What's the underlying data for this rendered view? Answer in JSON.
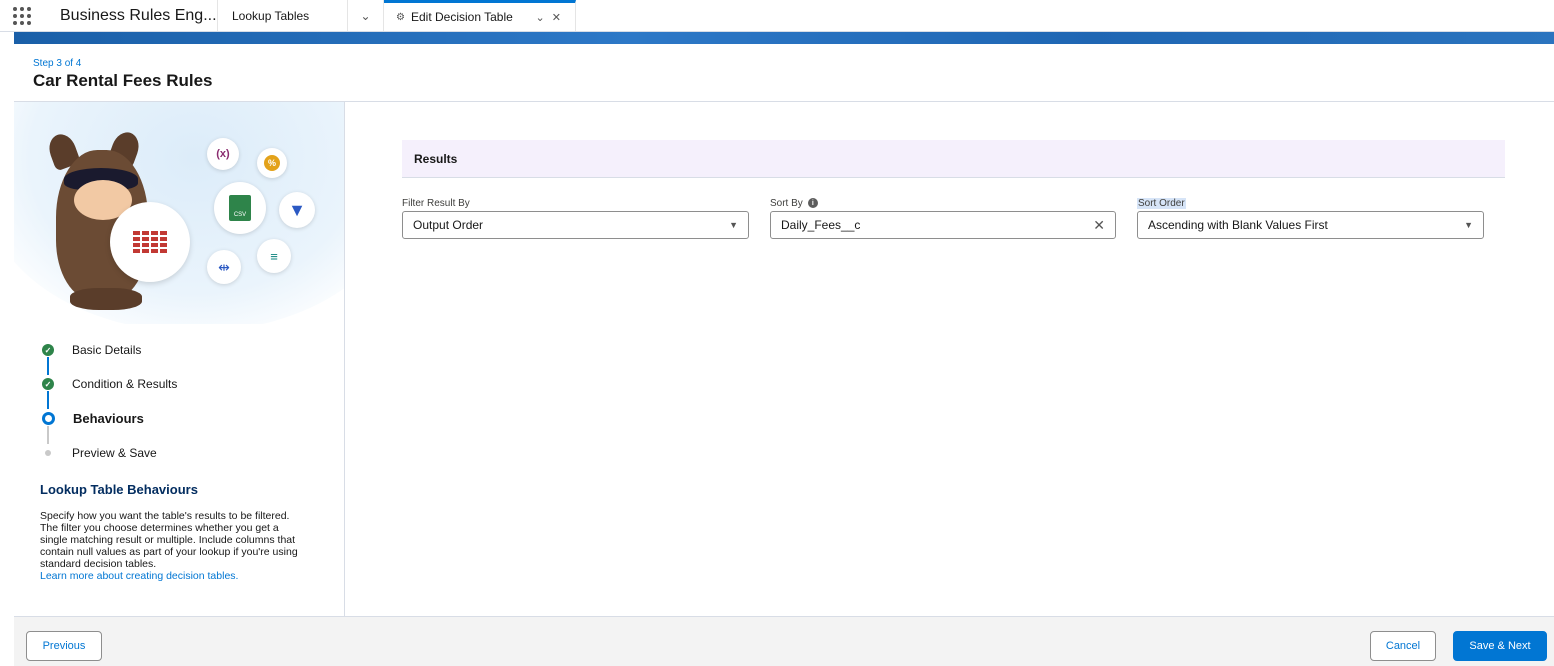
{
  "topnav": {
    "app_name": "Business Rules Eng...",
    "nav_item": "Lookup Tables",
    "nav_chevron": "⌄",
    "active_tab": {
      "label": "Edit Decision Table",
      "icon": "⚙",
      "actions": "⌄ ✕"
    }
  },
  "header": {
    "step": "Step 3 of 4",
    "title": "Car Rental Fees Rules"
  },
  "illustration": {
    "var_icon": "(x)",
    "percent_icon": "%",
    "csv_icon": "CSV",
    "filter_icon": "▼",
    "flow_icon": "⇹",
    "data_icon": "≡"
  },
  "steps": [
    {
      "label": "Basic Details",
      "status": "complete",
      "marker": "✓"
    },
    {
      "label": "Condition & Results",
      "status": "complete",
      "marker": "✓"
    },
    {
      "label": "Behaviours",
      "status": "current",
      "marker": ""
    },
    {
      "label": "Preview & Save",
      "status": "future",
      "marker": ""
    }
  ],
  "help": {
    "title": "Lookup Table Behaviours",
    "body": "Specify how you want the table's results to be filtered. The filter you choose determines whether you get a single matching result or multiple. Include columns that contain null values as part of your lookup if you're using standard decision tables.",
    "link": "Learn more about creating decision tables."
  },
  "results": {
    "section_title": "Results",
    "filter_result_by": {
      "label": "Filter Result By",
      "value": "Output Order",
      "caret": "▼"
    },
    "sort_by": {
      "label": "Sort By",
      "info": "i",
      "value": "Daily_Fees__c",
      "clear": "✕"
    },
    "sort_order": {
      "label": "Sort Order",
      "value": "Ascending with Blank Values First",
      "caret": "▼"
    }
  },
  "footer": {
    "previous": "Previous",
    "cancel": "Cancel",
    "save_next": "Save & Next"
  },
  "colors": {
    "brand": "#0176d3",
    "success": "#2e844a",
    "results_header_bg": "#f5f0fc"
  }
}
